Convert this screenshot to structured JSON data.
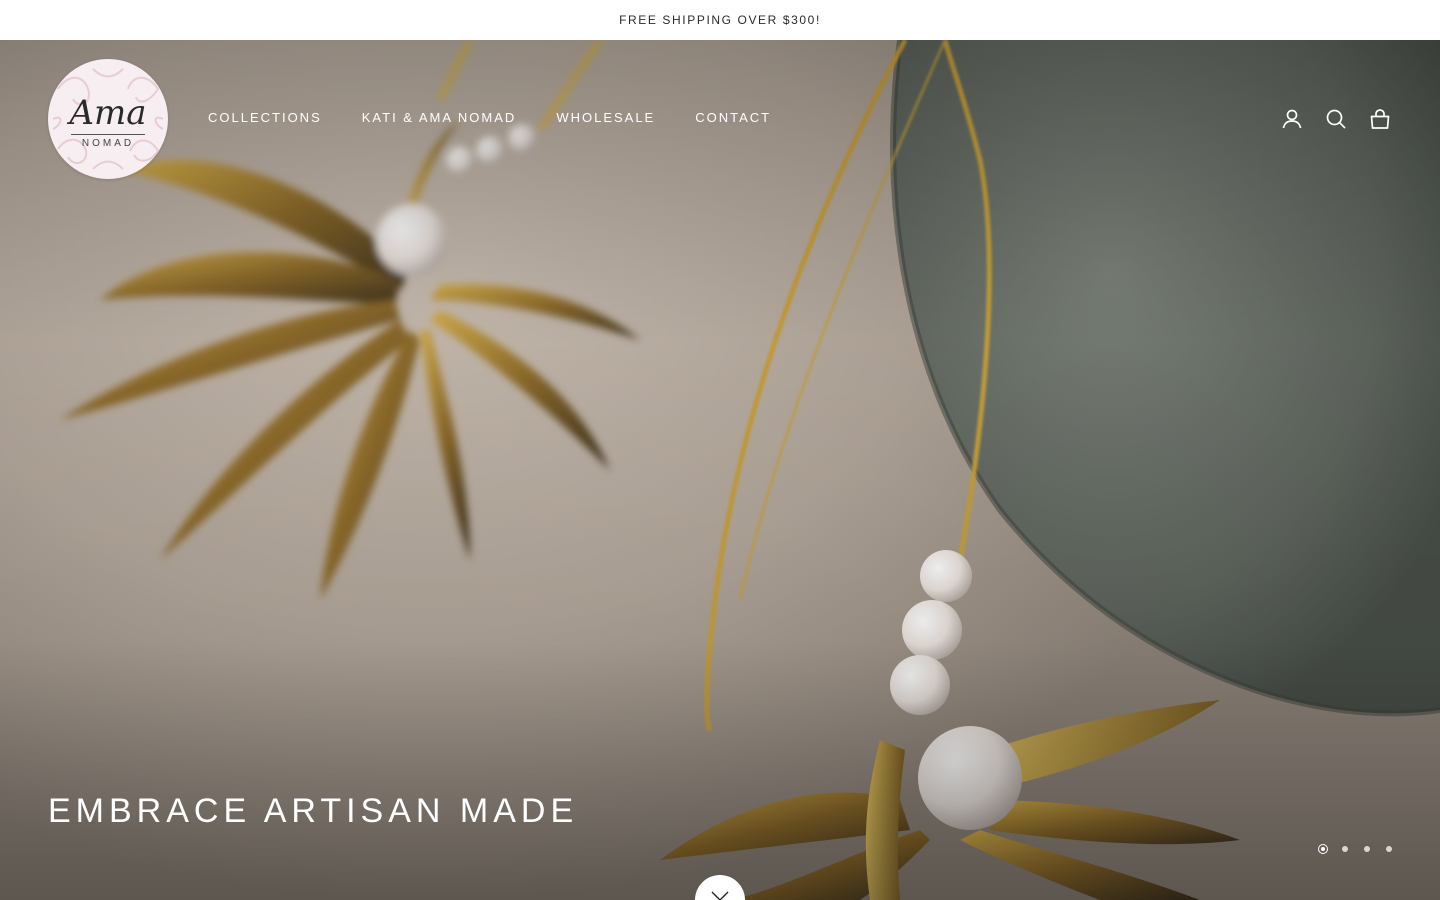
{
  "announcement": {
    "text": "FREE SHIPPING OVER $300!"
  },
  "logo": {
    "script": "Ama",
    "sub": "NOMAD"
  },
  "nav": {
    "items": [
      {
        "label": "COLLECTIONS"
      },
      {
        "label": "KATI & AMA NOMAD"
      },
      {
        "label": "WHOLESALE"
      },
      {
        "label": "CONTACT"
      }
    ]
  },
  "header_icons": [
    "account-icon",
    "search-icon",
    "cart-bag-icon"
  ],
  "hero": {
    "title": "EMBRACE ARTISAN MADE",
    "slides_total": 4,
    "active_slide": 1
  },
  "colors": {
    "announcement_bg": "#ffffff",
    "nav_text": "#ffffff",
    "logo_bg": "#f6eef0",
    "gold": "#c9a23a",
    "stone": "#6f756c"
  }
}
